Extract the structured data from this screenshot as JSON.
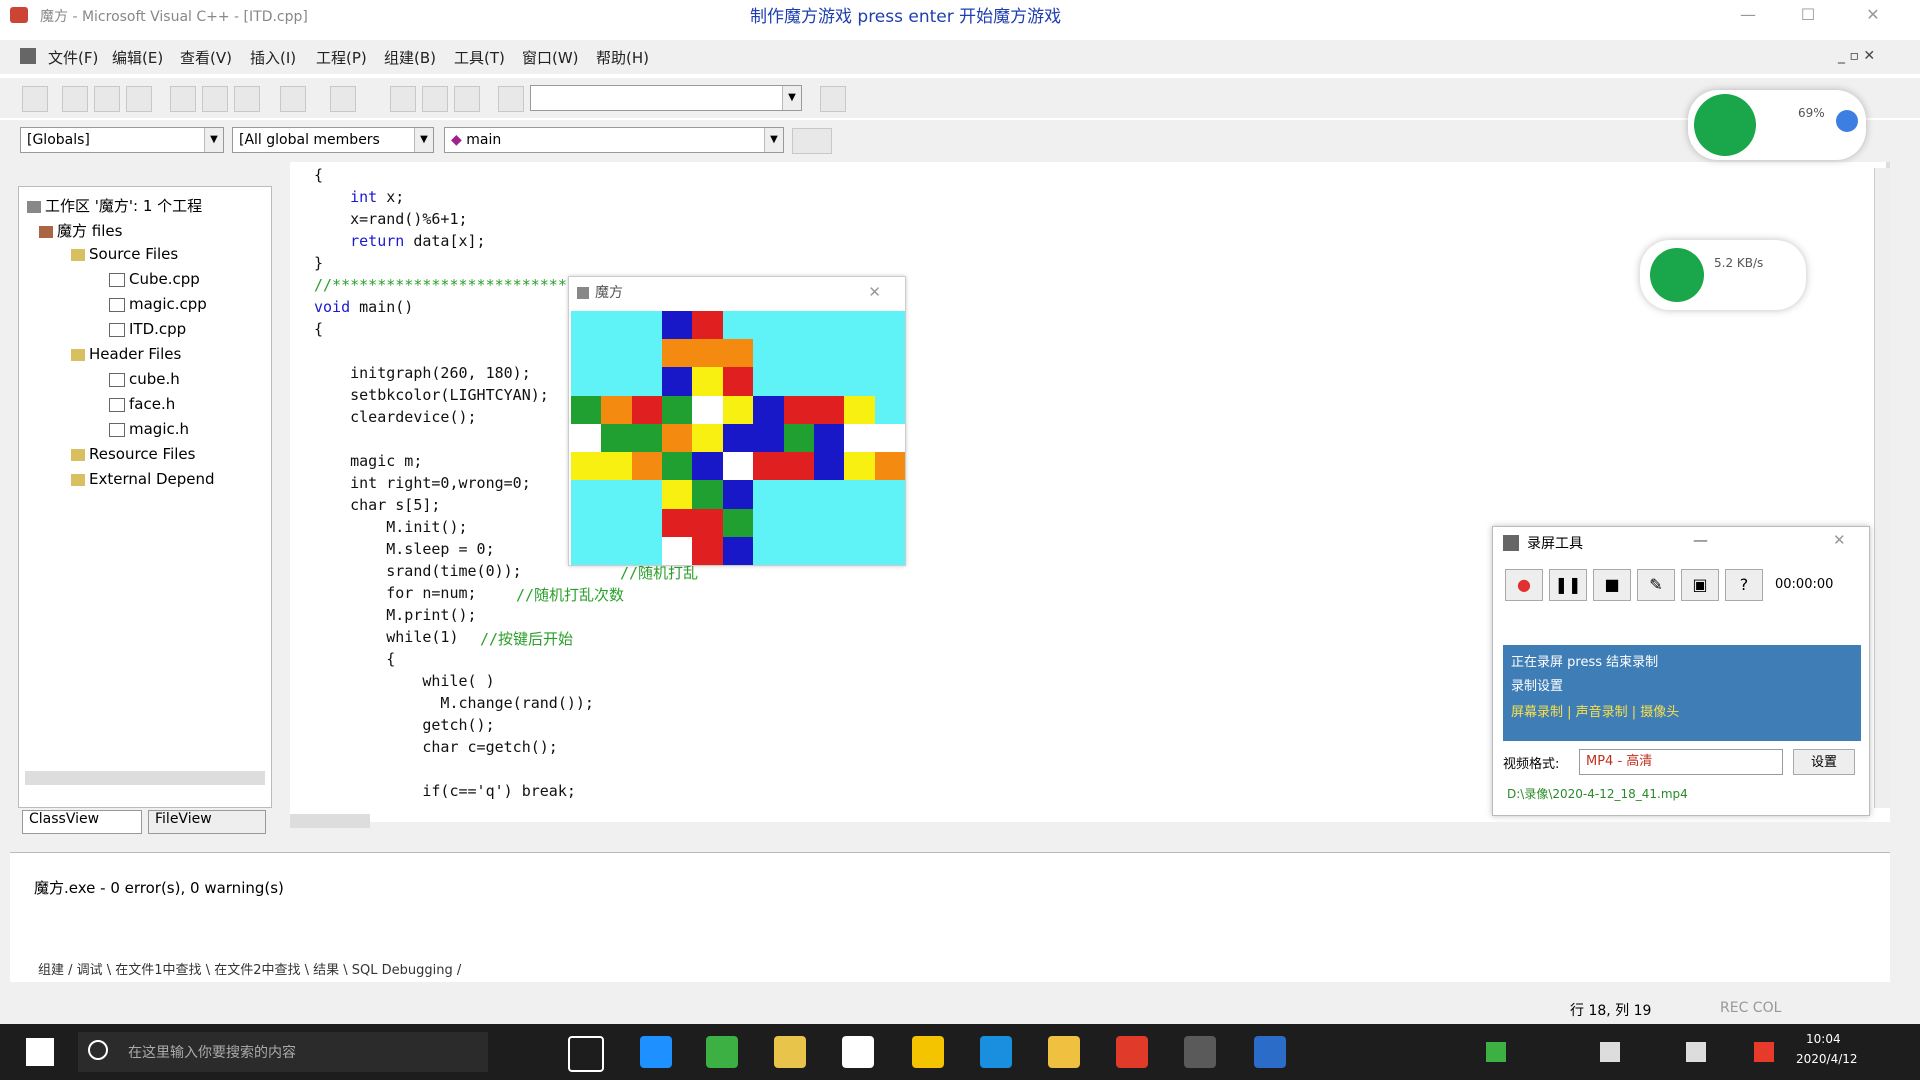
{
  "window": {
    "title": "魔方 - Microsoft Visual C++ - [ITD.cpp]",
    "center_title": "制作魔方游戏 press enter 开始魔方游戏",
    "minimize": "—",
    "maximize": "☐",
    "close": "✕"
  },
  "menu": [
    "文件(F)",
    "编辑(E)",
    "查看(V)",
    "插入(I)",
    "工程(P)",
    "组建(B)",
    "工具(T)",
    "窗口(W)",
    "帮助(H)"
  ],
  "combos": {
    "classes": "[Globals]",
    "members": "[All global members",
    "function": "main"
  },
  "tree": [
    "工作区 '魔方': 1 个工程",
    "魔方 files",
    "Source Files",
    "Cube.cpp",
    "magic.cpp",
    "ITD.cpp",
    "Header Files",
    "cube.h",
    "face.h",
    "magic.h",
    "Resource Files",
    "External Depend"
  ],
  "tree_tabs": [
    "ClassView",
    "FileView"
  ],
  "code": [
    "{",
    "    int x;",
    "    x=rand()%6+1;",
    "    return data[x];",
    "}",
    "//************************************",
    "void main()",
    "{",
    "",
    "    initgraph(260, 180);",
    "    setbkcolor(LIGHTCYAN);",
    "    cleardevice();",
    "",
    "    magic m;",
    "    int right=0,wrong=0;",
    "    char s[5];",
    "        M.init();",
    "        M.sleep = 0;",
    "        srand(time(0));",
    "        for n=num;",
    "        M.print();",
    "        while(1)",
    "        {",
    "            while( )",
    "              M.change(rand());",
    "            getch();",
    "            char c=getch();",
    "",
    "            if(c=='q') break;"
  ],
  "comments": {
    "c1": "//随机打乱",
    "c2": "//随机打乱次数",
    "c3": "//按键后开始"
  },
  "graph_window": {
    "title": "魔方",
    "close": "✕"
  },
  "recorder": {
    "title": "录屏工具",
    "timer": "00:00:00",
    "status_line1": "正在录屏 press 结束录制",
    "status_line2": "录制设置",
    "status_line3": "屏幕录制 | 声音录制 | 摄像头",
    "format_label": "视频格式:",
    "format_value": "MP4 - 高清",
    "format_btn": "设置",
    "path": "D:\\录像\\2020-4-12_18_41.mp4"
  },
  "output": {
    "line1": "魔方.exe - 0 error(s), 0 warning(s)",
    "tabs": "组建 / 调试 \\ 在文件1中查找 \\ 在文件2中查找 \\ 结果 \\ SQL Debugging /"
  },
  "status": {
    "position": "行 18, 列 19",
    "mode": "REC COL"
  },
  "widget": {
    "network": "5.2 KB/s",
    "percent": "69%"
  },
  "taskbar": {
    "search_placeholder": "在这里输入你要搜索的内容",
    "time": "10:04",
    "date": "2020/4/12"
  },
  "cube_colors": {
    "R": "#e02020",
    "B": "#1818c8",
    "O": "#f58a10",
    "Y": "#f8f010",
    "G": "#20a030",
    "W": "#ffffff"
  },
  "cube_grid": [
    "...BR......",
    "...OOO.....",
    "...BYR.....",
    "GORGWYBRRY.",
    "WGGOYBBGBWW",
    "YYOGBWRRBYO",
    "...YGB.....",
    "...RRG.....",
    "...WRB....."
  ]
}
